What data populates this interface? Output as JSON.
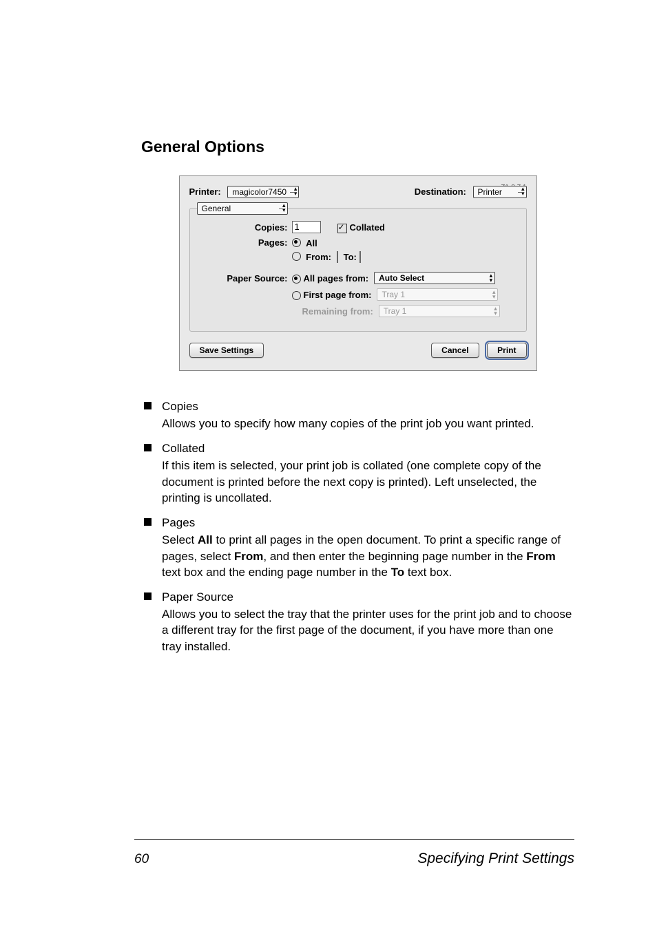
{
  "section_heading": "General Options",
  "dialog": {
    "version": "Z1-8.7.1",
    "printer_label": "Printer:",
    "printer_value": "magicolor7450",
    "destination_label": "Destination:",
    "destination_value": "Printer",
    "tab_legend": "General",
    "copies_label": "Copies:",
    "copies_value": "1",
    "collated_label": "Collated",
    "pages_label": "Pages:",
    "pages_all_label": "All",
    "pages_from_label": "From:",
    "pages_to_label": "To:",
    "paper_source_label": "Paper Source:",
    "ps_all_pages_label": "All pages from:",
    "ps_all_pages_value": "Auto Select",
    "ps_first_label": "First page from:",
    "ps_first_value": "Tray 1",
    "ps_remaining_label": "Remaining from:",
    "ps_remaining_value": "Tray 1",
    "btn_save": "Save Settings",
    "btn_cancel": "Cancel",
    "btn_print": "Print"
  },
  "bullets": [
    {
      "term": "Copies",
      "body": "Allows you to specify how many copies of the print job you want printed."
    },
    {
      "term": "Collated",
      "body": "If this item is selected, your print job is collated (one complete copy of the document is printed before the next copy is printed). Left unselected, the printing is uncollated."
    },
    {
      "term": "Pages",
      "body_html": "Select <b>All</b> to print all pages in the open document. To print a specific range of pages, select <b>From</b>, and then enter the beginning page number in the <b>From</b> text box and the ending page number in the <b>To</b> text box."
    },
    {
      "term": "Paper Source",
      "body": "Allows you to select the tray that the printer uses for the print job and to choose a different tray for the first page of the document, if you have more than one tray installed."
    }
  ],
  "footer": {
    "page_number": "60",
    "running_title": "Specifying Print Settings"
  }
}
